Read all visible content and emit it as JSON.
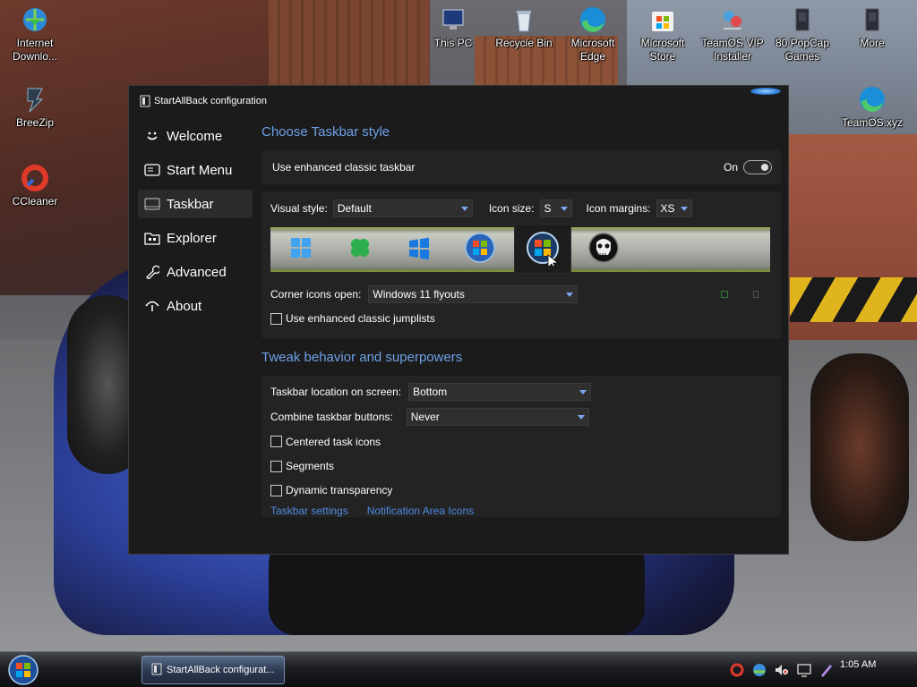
{
  "desktop": {
    "icons": [
      {
        "label": "Internet\nDownlo...",
        "name": "internet-download-manager"
      },
      {
        "label": "BreeZip",
        "name": "breezip"
      },
      {
        "label": "CCleaner",
        "name": "ccleaner"
      },
      {
        "label": "This PC",
        "name": "this-pc"
      },
      {
        "label": "Recycle Bin",
        "name": "recycle-bin"
      },
      {
        "label": "Microsoft\nEdge",
        "name": "microsoft-edge"
      },
      {
        "label": "Microsoft\nStore",
        "name": "microsoft-store"
      },
      {
        "label": "TeamOS VIP\nInstaller",
        "name": "teamos-vip-installer"
      },
      {
        "label": "80 PopCap\nGames",
        "name": "popcap-games"
      },
      {
        "label": "More",
        "name": "more"
      },
      {
        "label": "TeamOS.xyz",
        "name": "teamos-xyz"
      }
    ]
  },
  "window": {
    "title": "StartAllBack configuration",
    "nav": [
      {
        "label": "Welcome",
        "icon": "smiley-icon"
      },
      {
        "label": "Start Menu",
        "icon": "start-menu-icon"
      },
      {
        "label": "Taskbar",
        "icon": "taskbar-icon",
        "active": true
      },
      {
        "label": "Explorer",
        "icon": "folder-icon"
      },
      {
        "label": "Advanced",
        "icon": "wrench-icon"
      },
      {
        "label": "About",
        "icon": "about-icon"
      }
    ],
    "taskbar_style": {
      "section_title": "Choose Taskbar style",
      "enhanced_label": "Use enhanced classic taskbar",
      "enhanced_state": "On",
      "visual_style_label": "Visual style:",
      "visual_style_value": "Default",
      "icon_size_label": "Icon size:",
      "icon_size_value": "S",
      "icon_margins_label": "Icon margins:",
      "icon_margins_value": "XS",
      "styles": [
        "windows11-logo-icon",
        "clover-logo-icon",
        "windows10-logo-icon",
        "windows7-orb-icon",
        "windows-vista-orb-icon",
        "punisher-skull-icon"
      ],
      "selected_style": 4,
      "corner_icons_label": "Corner icons open:",
      "corner_icons_value": "Windows 11 flyouts",
      "jumplists_label": "Use enhanced classic jumplists"
    },
    "tweak": {
      "section_title": "Tweak behavior and superpowers",
      "location_label": "Taskbar location on screen:",
      "location_value": "Bottom",
      "combine_label": "Combine taskbar buttons:",
      "combine_value": "Never",
      "centered_label": "Centered task icons",
      "segments_label": "Segments",
      "transparency_label": "Dynamic transparency",
      "link_taskbar_settings": "Taskbar settings",
      "link_notification_icons": "Notification Area Icons"
    }
  },
  "taskbar": {
    "task_button_label": "StartAllBack configurat...",
    "clock": "1:05 AM",
    "tray_icons": [
      "ccleaner-tray-icon",
      "network-tray-icon",
      "volume-muted-icon",
      "display-icon",
      "pen-icon"
    ]
  },
  "colors": {
    "accent": "#6fa0e6",
    "link": "#4f8ae0",
    "window_bg": "#1b1b1b",
    "panel_bg": "#232323"
  }
}
